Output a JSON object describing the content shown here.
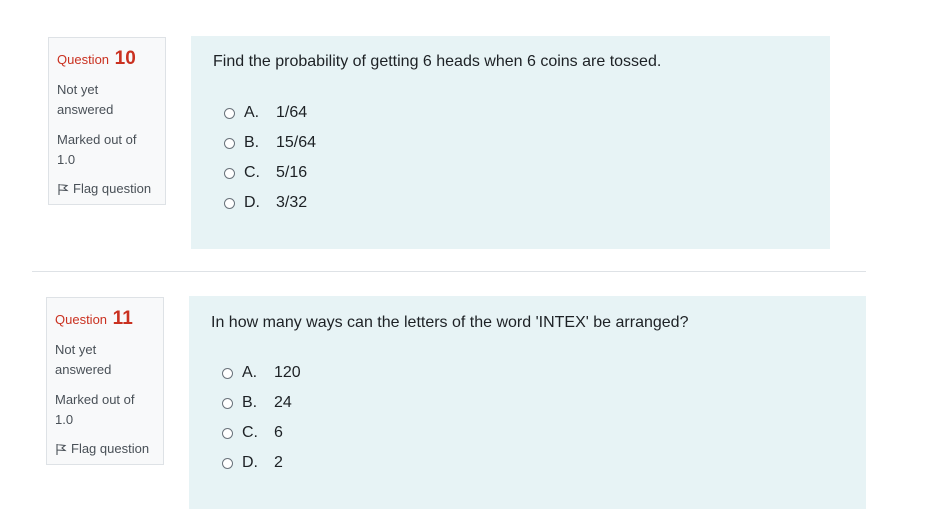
{
  "questions": [
    {
      "prefix": "Question",
      "number": "10",
      "state": "Not yet answered",
      "grade": "Marked out of 1.0",
      "flag_label": "Flag question",
      "text": "Find the probability of getting 6 heads when 6 coins are tossed.",
      "options": [
        {
          "letter": "A.",
          "value": "1/64"
        },
        {
          "letter": "B.",
          "value": "15/64"
        },
        {
          "letter": "C.",
          "value": "5/16"
        },
        {
          "letter": "D.",
          "value": "3/32"
        }
      ]
    },
    {
      "prefix": "Question",
      "number": "11",
      "state": "Not yet answered",
      "grade": "Marked out of 1.0",
      "flag_label": "Flag question",
      "text": "In how many ways can the letters of the word 'INTEX' be arranged?",
      "options": [
        {
          "letter": "A.",
          "value": "120"
        },
        {
          "letter": "B.",
          "value": "24"
        },
        {
          "letter": "C.",
          "value": "6"
        },
        {
          "letter": "D.",
          "value": "2"
        }
      ]
    }
  ],
  "colors": {
    "question_number": "#ca3120",
    "content_bg": "#e7f3f5",
    "info_bg": "#f8f9fa"
  },
  "icons": {
    "flag": "flag-icon",
    "radio": "radio-unchecked-icon"
  }
}
